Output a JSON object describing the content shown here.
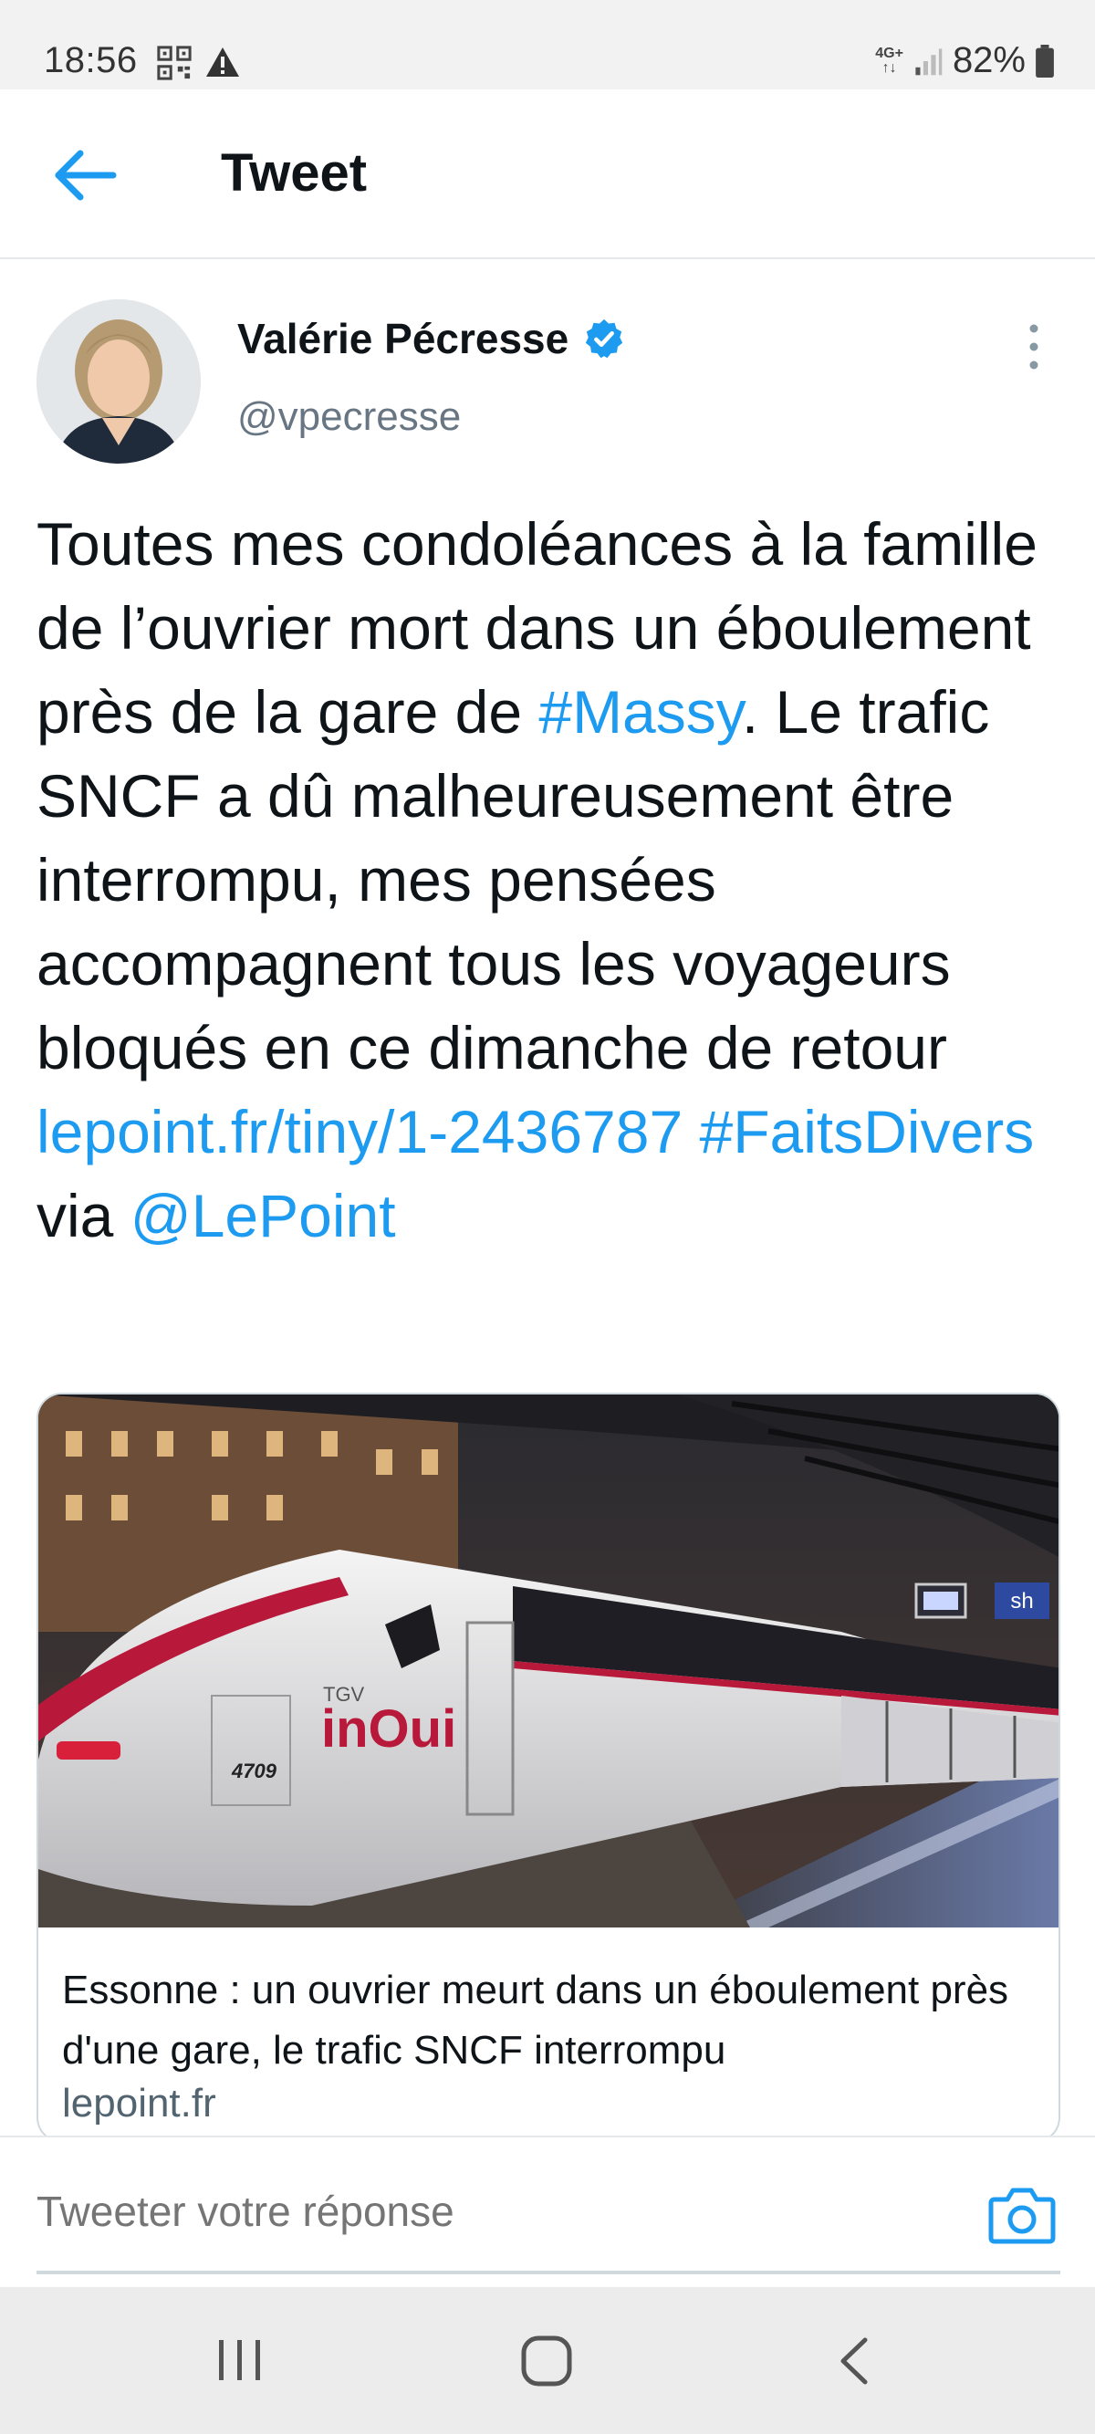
{
  "status_bar": {
    "time": "18:56",
    "network": "4G+",
    "battery": "82%",
    "icons": [
      "qr-code-icon",
      "warning-icon",
      "signal-icon",
      "battery-icon"
    ]
  },
  "header": {
    "title": "Tweet",
    "back_icon": "back-arrow-icon"
  },
  "author": {
    "name": "Valérie Pécresse",
    "handle": "@vpecresse",
    "verified": true
  },
  "tweet": {
    "text_1": "Toutes mes condoléances à la famille de l’ouvrier mort dans un éboulement près de la gare de ",
    "hashtag_1": "#Massy",
    "text_2": ". Le trafic SNCF a dû malheureusement être interrompu, mes pensées accompagnent tous les voyageurs bloqués en ce dimanche de retour ",
    "link": "lepoint.fr/tiny/1-2436787",
    "hashtag_2": "#FaitsDivers",
    "text_3": " via ",
    "mention": "@LePoint"
  },
  "card": {
    "image_train_number": "4709",
    "image_brand_small": "TGV",
    "image_brand": "inOui",
    "image_sign": "sh",
    "title": "Essonne : un ouvrier meurt dans un éboulement près d'une gare, le trafic SNCF interrompu",
    "domain": "lepoint.fr"
  },
  "reply": {
    "placeholder": "Tweeter votre réponse",
    "camera_icon": "camera-icon"
  },
  "nav": {
    "icons": [
      "recents-icon",
      "home-icon",
      "back-icon"
    ]
  },
  "colors": {
    "accent": "#1d9bf0",
    "text": "#0f1419",
    "secondary": "#536471"
  }
}
